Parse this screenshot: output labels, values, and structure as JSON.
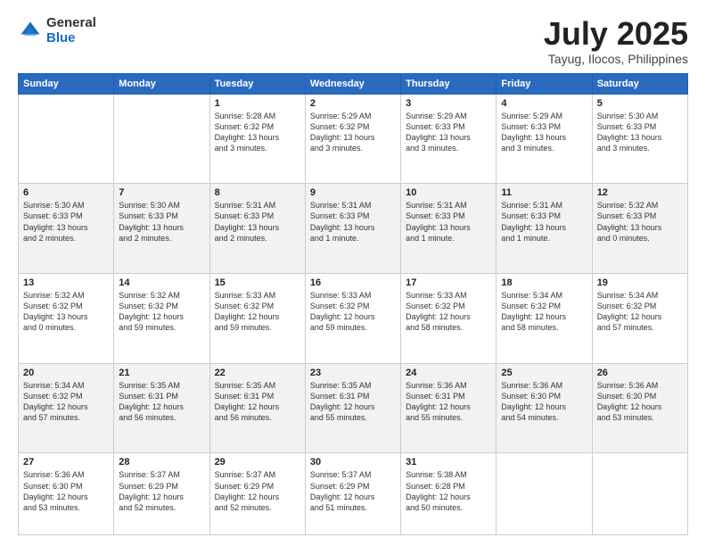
{
  "header": {
    "logo_general": "General",
    "logo_blue": "Blue",
    "title": "July 2025",
    "location": "Tayug, Ilocos, Philippines"
  },
  "weekdays": [
    "Sunday",
    "Monday",
    "Tuesday",
    "Wednesday",
    "Thursday",
    "Friday",
    "Saturday"
  ],
  "weeks": [
    [
      {
        "day": "",
        "detail": ""
      },
      {
        "day": "",
        "detail": ""
      },
      {
        "day": "1",
        "detail": "Sunrise: 5:28 AM\nSunset: 6:32 PM\nDaylight: 13 hours\nand 3 minutes."
      },
      {
        "day": "2",
        "detail": "Sunrise: 5:29 AM\nSunset: 6:32 PM\nDaylight: 13 hours\nand 3 minutes."
      },
      {
        "day": "3",
        "detail": "Sunrise: 5:29 AM\nSunset: 6:33 PM\nDaylight: 13 hours\nand 3 minutes."
      },
      {
        "day": "4",
        "detail": "Sunrise: 5:29 AM\nSunset: 6:33 PM\nDaylight: 13 hours\nand 3 minutes."
      },
      {
        "day": "5",
        "detail": "Sunrise: 5:30 AM\nSunset: 6:33 PM\nDaylight: 13 hours\nand 3 minutes."
      }
    ],
    [
      {
        "day": "6",
        "detail": "Sunrise: 5:30 AM\nSunset: 6:33 PM\nDaylight: 13 hours\nand 2 minutes."
      },
      {
        "day": "7",
        "detail": "Sunrise: 5:30 AM\nSunset: 6:33 PM\nDaylight: 13 hours\nand 2 minutes."
      },
      {
        "day": "8",
        "detail": "Sunrise: 5:31 AM\nSunset: 6:33 PM\nDaylight: 13 hours\nand 2 minutes."
      },
      {
        "day": "9",
        "detail": "Sunrise: 5:31 AM\nSunset: 6:33 PM\nDaylight: 13 hours\nand 1 minute."
      },
      {
        "day": "10",
        "detail": "Sunrise: 5:31 AM\nSunset: 6:33 PM\nDaylight: 13 hours\nand 1 minute."
      },
      {
        "day": "11",
        "detail": "Sunrise: 5:31 AM\nSunset: 6:33 PM\nDaylight: 13 hours\nand 1 minute."
      },
      {
        "day": "12",
        "detail": "Sunrise: 5:32 AM\nSunset: 6:33 PM\nDaylight: 13 hours\nand 0 minutes."
      }
    ],
    [
      {
        "day": "13",
        "detail": "Sunrise: 5:32 AM\nSunset: 6:32 PM\nDaylight: 13 hours\nand 0 minutes."
      },
      {
        "day": "14",
        "detail": "Sunrise: 5:32 AM\nSunset: 6:32 PM\nDaylight: 12 hours\nand 59 minutes."
      },
      {
        "day": "15",
        "detail": "Sunrise: 5:33 AM\nSunset: 6:32 PM\nDaylight: 12 hours\nand 59 minutes."
      },
      {
        "day": "16",
        "detail": "Sunrise: 5:33 AM\nSunset: 6:32 PM\nDaylight: 12 hours\nand 59 minutes."
      },
      {
        "day": "17",
        "detail": "Sunrise: 5:33 AM\nSunset: 6:32 PM\nDaylight: 12 hours\nand 58 minutes."
      },
      {
        "day": "18",
        "detail": "Sunrise: 5:34 AM\nSunset: 6:32 PM\nDaylight: 12 hours\nand 58 minutes."
      },
      {
        "day": "19",
        "detail": "Sunrise: 5:34 AM\nSunset: 6:32 PM\nDaylight: 12 hours\nand 57 minutes."
      }
    ],
    [
      {
        "day": "20",
        "detail": "Sunrise: 5:34 AM\nSunset: 6:32 PM\nDaylight: 12 hours\nand 57 minutes."
      },
      {
        "day": "21",
        "detail": "Sunrise: 5:35 AM\nSunset: 6:31 PM\nDaylight: 12 hours\nand 56 minutes."
      },
      {
        "day": "22",
        "detail": "Sunrise: 5:35 AM\nSunset: 6:31 PM\nDaylight: 12 hours\nand 56 minutes."
      },
      {
        "day": "23",
        "detail": "Sunrise: 5:35 AM\nSunset: 6:31 PM\nDaylight: 12 hours\nand 55 minutes."
      },
      {
        "day": "24",
        "detail": "Sunrise: 5:36 AM\nSunset: 6:31 PM\nDaylight: 12 hours\nand 55 minutes."
      },
      {
        "day": "25",
        "detail": "Sunrise: 5:36 AM\nSunset: 6:30 PM\nDaylight: 12 hours\nand 54 minutes."
      },
      {
        "day": "26",
        "detail": "Sunrise: 5:36 AM\nSunset: 6:30 PM\nDaylight: 12 hours\nand 53 minutes."
      }
    ],
    [
      {
        "day": "27",
        "detail": "Sunrise: 5:36 AM\nSunset: 6:30 PM\nDaylight: 12 hours\nand 53 minutes."
      },
      {
        "day": "28",
        "detail": "Sunrise: 5:37 AM\nSunset: 6:29 PM\nDaylight: 12 hours\nand 52 minutes."
      },
      {
        "day": "29",
        "detail": "Sunrise: 5:37 AM\nSunset: 6:29 PM\nDaylight: 12 hours\nand 52 minutes."
      },
      {
        "day": "30",
        "detail": "Sunrise: 5:37 AM\nSunset: 6:29 PM\nDaylight: 12 hours\nand 51 minutes."
      },
      {
        "day": "31",
        "detail": "Sunrise: 5:38 AM\nSunset: 6:28 PM\nDaylight: 12 hours\nand 50 minutes."
      },
      {
        "day": "",
        "detail": ""
      },
      {
        "day": "",
        "detail": ""
      }
    ]
  ]
}
